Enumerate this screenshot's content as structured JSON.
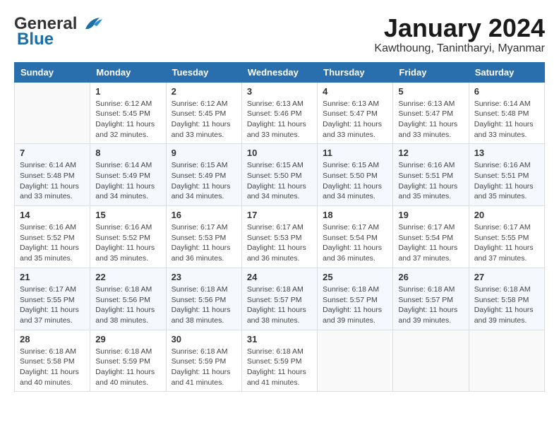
{
  "header": {
    "logo_general": "General",
    "logo_blue": "Blue",
    "month_title": "January 2024",
    "location": "Kawthoung, Tanintharyi, Myanmar"
  },
  "days_of_week": [
    "Sunday",
    "Monday",
    "Tuesday",
    "Wednesday",
    "Thursday",
    "Friday",
    "Saturday"
  ],
  "weeks": [
    [
      {
        "day": "",
        "info": ""
      },
      {
        "day": "1",
        "info": "Sunrise: 6:12 AM\nSunset: 5:45 PM\nDaylight: 11 hours\nand 32 minutes."
      },
      {
        "day": "2",
        "info": "Sunrise: 6:12 AM\nSunset: 5:45 PM\nDaylight: 11 hours\nand 33 minutes."
      },
      {
        "day": "3",
        "info": "Sunrise: 6:13 AM\nSunset: 5:46 PM\nDaylight: 11 hours\nand 33 minutes."
      },
      {
        "day": "4",
        "info": "Sunrise: 6:13 AM\nSunset: 5:47 PM\nDaylight: 11 hours\nand 33 minutes."
      },
      {
        "day": "5",
        "info": "Sunrise: 6:13 AM\nSunset: 5:47 PM\nDaylight: 11 hours\nand 33 minutes."
      },
      {
        "day": "6",
        "info": "Sunrise: 6:14 AM\nSunset: 5:48 PM\nDaylight: 11 hours\nand 33 minutes."
      }
    ],
    [
      {
        "day": "7",
        "info": "Sunrise: 6:14 AM\nSunset: 5:48 PM\nDaylight: 11 hours\nand 33 minutes."
      },
      {
        "day": "8",
        "info": "Sunrise: 6:14 AM\nSunset: 5:49 PM\nDaylight: 11 hours\nand 34 minutes."
      },
      {
        "day": "9",
        "info": "Sunrise: 6:15 AM\nSunset: 5:49 PM\nDaylight: 11 hours\nand 34 minutes."
      },
      {
        "day": "10",
        "info": "Sunrise: 6:15 AM\nSunset: 5:50 PM\nDaylight: 11 hours\nand 34 minutes."
      },
      {
        "day": "11",
        "info": "Sunrise: 6:15 AM\nSunset: 5:50 PM\nDaylight: 11 hours\nand 34 minutes."
      },
      {
        "day": "12",
        "info": "Sunrise: 6:16 AM\nSunset: 5:51 PM\nDaylight: 11 hours\nand 35 minutes."
      },
      {
        "day": "13",
        "info": "Sunrise: 6:16 AM\nSunset: 5:51 PM\nDaylight: 11 hours\nand 35 minutes."
      }
    ],
    [
      {
        "day": "14",
        "info": "Sunrise: 6:16 AM\nSunset: 5:52 PM\nDaylight: 11 hours\nand 35 minutes."
      },
      {
        "day": "15",
        "info": "Sunrise: 6:16 AM\nSunset: 5:52 PM\nDaylight: 11 hours\nand 35 minutes."
      },
      {
        "day": "16",
        "info": "Sunrise: 6:17 AM\nSunset: 5:53 PM\nDaylight: 11 hours\nand 36 minutes."
      },
      {
        "day": "17",
        "info": "Sunrise: 6:17 AM\nSunset: 5:53 PM\nDaylight: 11 hours\nand 36 minutes."
      },
      {
        "day": "18",
        "info": "Sunrise: 6:17 AM\nSunset: 5:54 PM\nDaylight: 11 hours\nand 36 minutes."
      },
      {
        "day": "19",
        "info": "Sunrise: 6:17 AM\nSunset: 5:54 PM\nDaylight: 11 hours\nand 37 minutes."
      },
      {
        "day": "20",
        "info": "Sunrise: 6:17 AM\nSunset: 5:55 PM\nDaylight: 11 hours\nand 37 minutes."
      }
    ],
    [
      {
        "day": "21",
        "info": "Sunrise: 6:17 AM\nSunset: 5:55 PM\nDaylight: 11 hours\nand 37 minutes."
      },
      {
        "day": "22",
        "info": "Sunrise: 6:18 AM\nSunset: 5:56 PM\nDaylight: 11 hours\nand 38 minutes."
      },
      {
        "day": "23",
        "info": "Sunrise: 6:18 AM\nSunset: 5:56 PM\nDaylight: 11 hours\nand 38 minutes."
      },
      {
        "day": "24",
        "info": "Sunrise: 6:18 AM\nSunset: 5:57 PM\nDaylight: 11 hours\nand 38 minutes."
      },
      {
        "day": "25",
        "info": "Sunrise: 6:18 AM\nSunset: 5:57 PM\nDaylight: 11 hours\nand 39 minutes."
      },
      {
        "day": "26",
        "info": "Sunrise: 6:18 AM\nSunset: 5:57 PM\nDaylight: 11 hours\nand 39 minutes."
      },
      {
        "day": "27",
        "info": "Sunrise: 6:18 AM\nSunset: 5:58 PM\nDaylight: 11 hours\nand 39 minutes."
      }
    ],
    [
      {
        "day": "28",
        "info": "Sunrise: 6:18 AM\nSunset: 5:58 PM\nDaylight: 11 hours\nand 40 minutes."
      },
      {
        "day": "29",
        "info": "Sunrise: 6:18 AM\nSunset: 5:59 PM\nDaylight: 11 hours\nand 40 minutes."
      },
      {
        "day": "30",
        "info": "Sunrise: 6:18 AM\nSunset: 5:59 PM\nDaylight: 11 hours\nand 41 minutes."
      },
      {
        "day": "31",
        "info": "Sunrise: 6:18 AM\nSunset: 5:59 PM\nDaylight: 11 hours\nand 41 minutes."
      },
      {
        "day": "",
        "info": ""
      },
      {
        "day": "",
        "info": ""
      },
      {
        "day": "",
        "info": ""
      }
    ]
  ]
}
